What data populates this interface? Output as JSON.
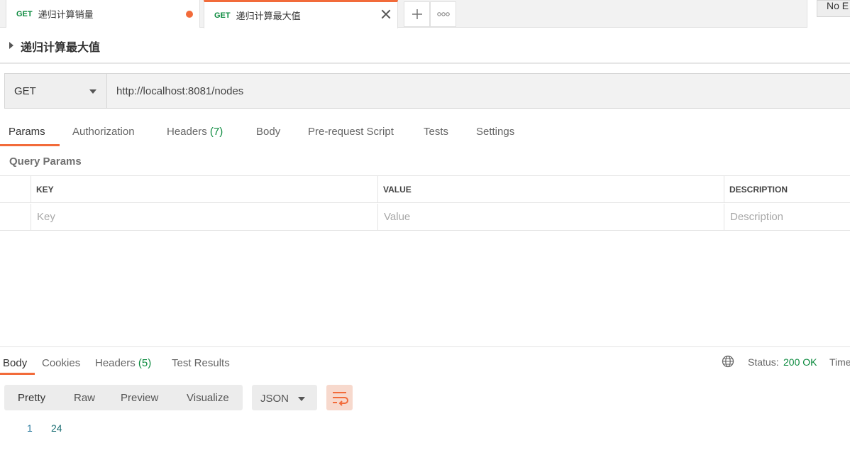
{
  "tabs": [
    {
      "method": "GET",
      "title": "递归计算销量",
      "unsaved": true
    },
    {
      "method": "GET",
      "title": "递归计算最大值",
      "active": true
    }
  ],
  "environment": {
    "label": "No E"
  },
  "request": {
    "name": "递归计算最大值",
    "method": "GET",
    "url": "http://localhost:8081/nodes"
  },
  "request_tabs": [
    {
      "label": "Params",
      "count": ""
    },
    {
      "label": "Authorization",
      "count": ""
    },
    {
      "label": "Headers",
      "count": "(7)"
    },
    {
      "label": "Body",
      "count": ""
    },
    {
      "label": "Pre-request Script",
      "count": ""
    },
    {
      "label": "Tests",
      "count": ""
    },
    {
      "label": "Settings",
      "count": ""
    }
  ],
  "query_params": {
    "title": "Query Params",
    "columns": [
      "KEY",
      "VALUE",
      "DESCRIPTION"
    ],
    "placeholders": {
      "key": "Key",
      "value": "Value",
      "description": "Description"
    }
  },
  "response_tabs": [
    {
      "label": "Body",
      "count": ""
    },
    {
      "label": "Cookies",
      "count": ""
    },
    {
      "label": "Headers",
      "count": "(5)"
    },
    {
      "label": "Test Results",
      "count": ""
    }
  ],
  "status": {
    "label": "Status:",
    "value": "200 OK",
    "time_label": "Time"
  },
  "view_modes": [
    "Pretty",
    "Raw",
    "Preview",
    "Visualize"
  ],
  "format": "JSON",
  "body_lines": [
    {
      "no": "1",
      "text": "24"
    }
  ],
  "colors": {
    "accent": "#f26b3a",
    "success": "#0b8a3e"
  }
}
